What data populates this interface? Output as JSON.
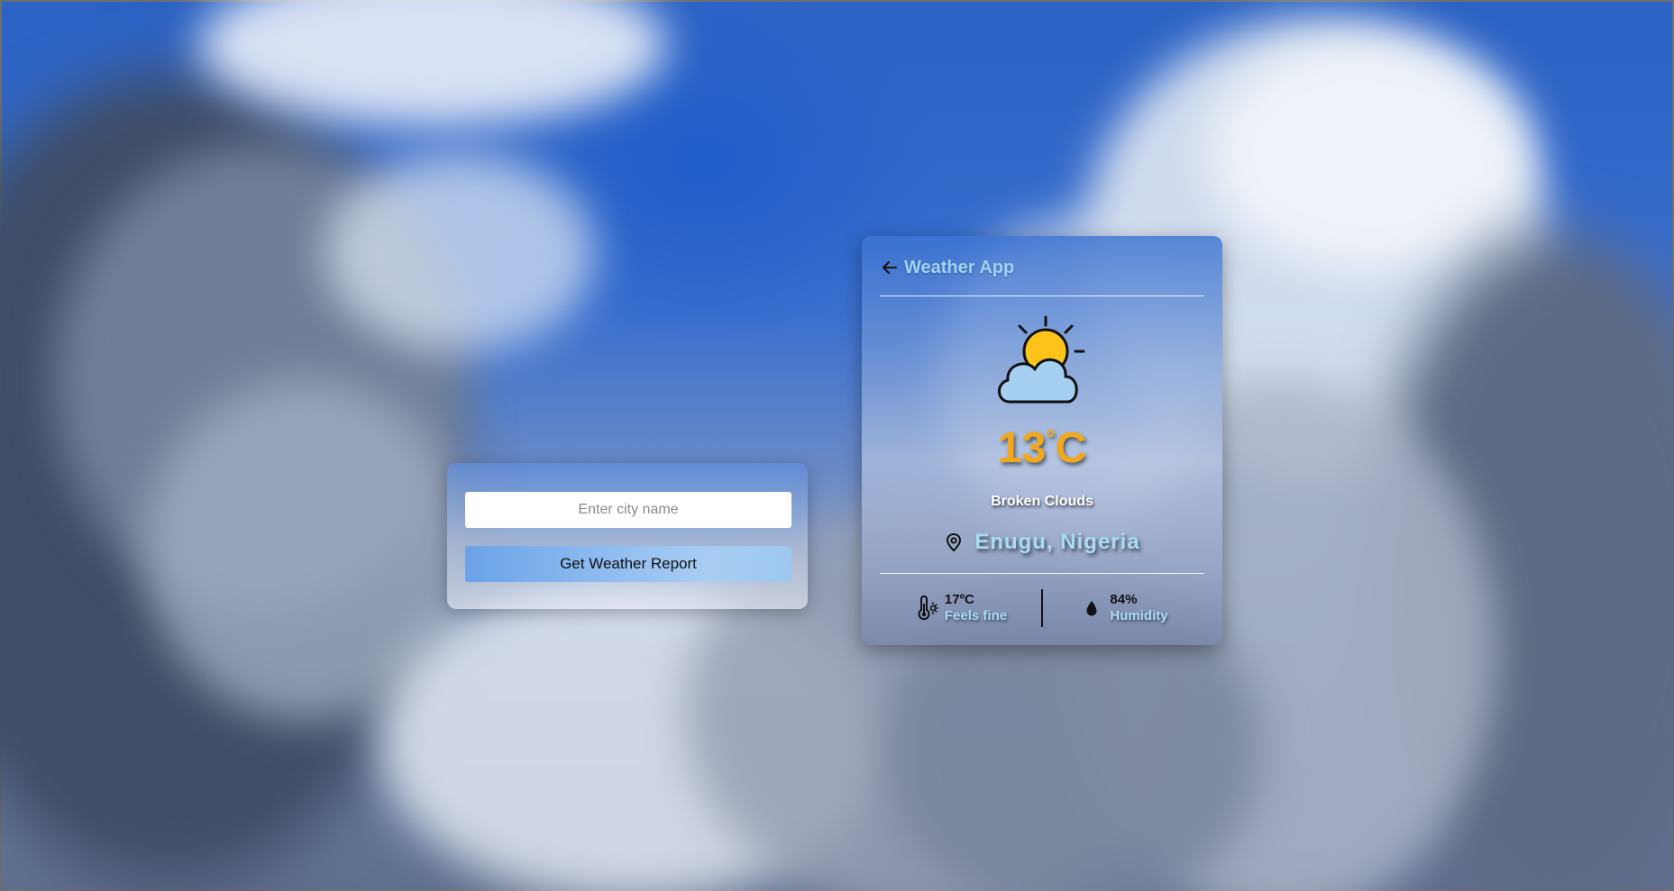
{
  "search": {
    "placeholder": "Enter city name",
    "value": "",
    "button_label": "Get Weather Report"
  },
  "card": {
    "title": "Weather App",
    "temperature_value": "13",
    "temperature_degree": "°",
    "temperature_unit": "C",
    "description": "Broken Clouds",
    "location": "Enugu, Nigeria",
    "feels_like_value": "17ºC",
    "feels_like_label": "Feels fine",
    "humidity_value": "84%",
    "humidity_label": "Humidity"
  },
  "icons": {
    "back": "arrow-left-icon",
    "weather": "partly-cloudy-icon",
    "location": "map-pin-icon",
    "feels_like": "thermometer-icon",
    "humidity": "water-drop-icon"
  },
  "colors": {
    "title": "#9fd3f5",
    "temperature": "#f2a81c",
    "location": "#a8dcf5",
    "sun": "#fcc419",
    "cloud": "#a5d0f2"
  }
}
